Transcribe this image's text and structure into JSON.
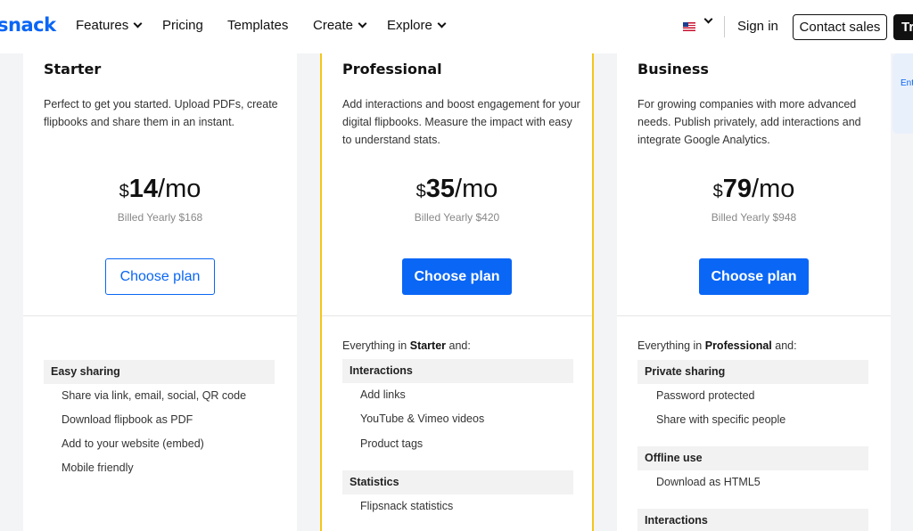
{
  "nav": {
    "logo": "snack",
    "items": [
      "Features",
      "Pricing",
      "Templates",
      "Create",
      "Explore"
    ],
    "sign_in": "Sign in",
    "contact_sales": "Contact sales",
    "try_label": "Tr"
  },
  "plans": [
    {
      "name": "Starter",
      "description": "Perfect to get you started. Upload PDFs, create flipbooks and share them in an instant.",
      "currency": "$",
      "amount": "14",
      "period": "/mo",
      "billed": "Billed Yearly $168",
      "cta": "Choose plan",
      "intro_prefix": "",
      "intro_plan": "",
      "intro_suffix": "",
      "groups": [
        {
          "heading": "Easy sharing",
          "items": [
            "Share via link, email, social, QR code",
            "Download flipbook as PDF",
            "Add to your website (embed)",
            "Mobile friendly"
          ]
        }
      ]
    },
    {
      "name": "Professional",
      "description": "Add interactions and boost engagement for your digital flipbooks. Measure the impact with easy to understand stats.",
      "currency": "$",
      "amount": "35",
      "period": "/mo",
      "billed": "Billed Yearly $420",
      "cta": "Choose plan",
      "intro_prefix": "Everything in ",
      "intro_plan": "Starter",
      "intro_suffix": " and:",
      "groups": [
        {
          "heading": "Interactions",
          "items": [
            "Add links",
            "YouTube & Vimeo videos",
            "Product tags"
          ]
        },
        {
          "heading": "Statistics",
          "items": [
            "Flipsnack statistics"
          ]
        }
      ]
    },
    {
      "name": "Business",
      "description": "For growing companies with more advanced needs. Publish privately, add interactions and integrate Google Analytics.",
      "currency": "$",
      "amount": "79",
      "period": "/mo",
      "billed": "Billed Yearly $948",
      "cta": "Choose plan",
      "intro_prefix": "Everything in ",
      "intro_plan": "Professional",
      "intro_suffix": " and:",
      "groups": [
        {
          "heading": "Private sharing",
          "items": [
            "Password protected",
            "Share with specific people"
          ]
        },
        {
          "heading": "Offline use",
          "items": [
            "Download as HTML5"
          ]
        },
        {
          "heading": "Interactions",
          "items": []
        }
      ]
    }
  ],
  "enterprise_peek": "Ent",
  "colors": {
    "accent": "#0a66f5",
    "highlight_border": "#f5c518"
  }
}
